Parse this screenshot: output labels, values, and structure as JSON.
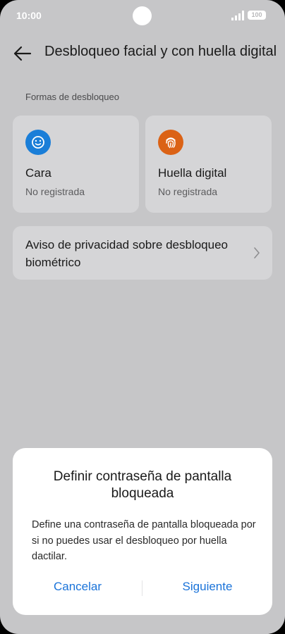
{
  "status_bar": {
    "time": "10:00",
    "battery": "100"
  },
  "header": {
    "title": "Desbloqueo facial y con huella digital"
  },
  "section": {
    "label": "Formas de desbloqueo"
  },
  "unlock_methods": [
    {
      "title": "Cara",
      "status": "No registrada",
      "icon": "face-icon",
      "color": "#1a7ed8"
    },
    {
      "title": "Huella digital",
      "status": "No registrada",
      "icon": "fingerprint-icon",
      "color": "#db6215"
    }
  ],
  "privacy": {
    "label": "Aviso de privacidad sobre desbloqueo biométrico"
  },
  "dialog": {
    "title": "Definir contraseña de pantalla bloqueada",
    "body": "Define una contraseña de pantalla bloqueada por si no puedes usar el desbloqueo por huella dactilar.",
    "cancel_label": "Cancelar",
    "next_label": "Siguiente"
  },
  "colors": {
    "accent": "#1a73d9",
    "background_dimmed": "#c6c6c8"
  }
}
